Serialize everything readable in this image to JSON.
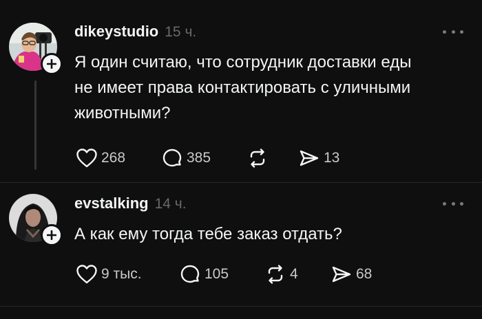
{
  "posts": [
    {
      "username": "dikeystudio",
      "time": "15 ч.",
      "text_lines": [
        "Я один считаю, что сотрудник доставки еды",
        "не имеет права контактировать с уличными",
        "животными?"
      ],
      "likes": "268",
      "comments": "385",
      "reposts": "",
      "shares": "13"
    },
    {
      "username": "evstalking",
      "time": "14 ч.",
      "text_lines": [
        "А как ему тогда тебе заказ отдать?"
      ],
      "likes": "9 тыс.",
      "comments": "105",
      "reposts": "4",
      "shares": "68"
    }
  ],
  "icons": {
    "like": "heart-icon",
    "comment": "comment-bubble-icon",
    "repost": "repost-icon",
    "share": "send-icon",
    "more": "more-dots-icon",
    "follow": "plus-icon"
  },
  "colors": {
    "background": "#0f0f0f",
    "text": "#f3f5f7",
    "secondary": "#666a6e"
  }
}
